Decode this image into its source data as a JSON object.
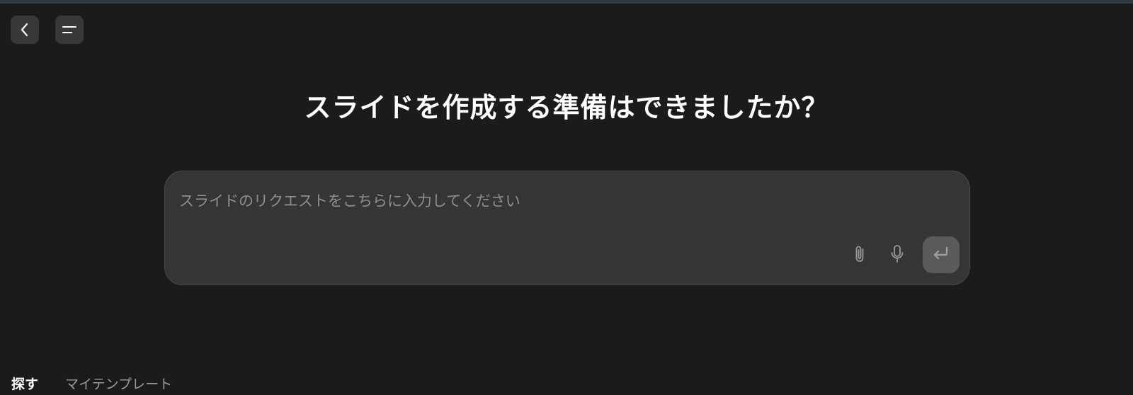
{
  "header": {
    "back_icon": "chevron-left-icon",
    "menu_icon": "menu-lines-icon"
  },
  "main": {
    "title": "スライドを作成する準備はできましたか？"
  },
  "composer": {
    "placeholder": "スライドのリクエストをこちらに入力してください",
    "value": "",
    "attach_icon": "paperclip-icon",
    "mic_icon": "microphone-icon",
    "send_icon": "enter-arrow-icon"
  },
  "tabs": [
    {
      "label": "探す",
      "active": true
    },
    {
      "label": "マイテンプレート",
      "active": false
    }
  ],
  "colors": {
    "background": "#1b1b1b",
    "surface": "#353535",
    "button": "#383838",
    "send_button": "#5a5a5a",
    "text_primary": "#ffffff",
    "text_muted": "#8e8e8e"
  }
}
